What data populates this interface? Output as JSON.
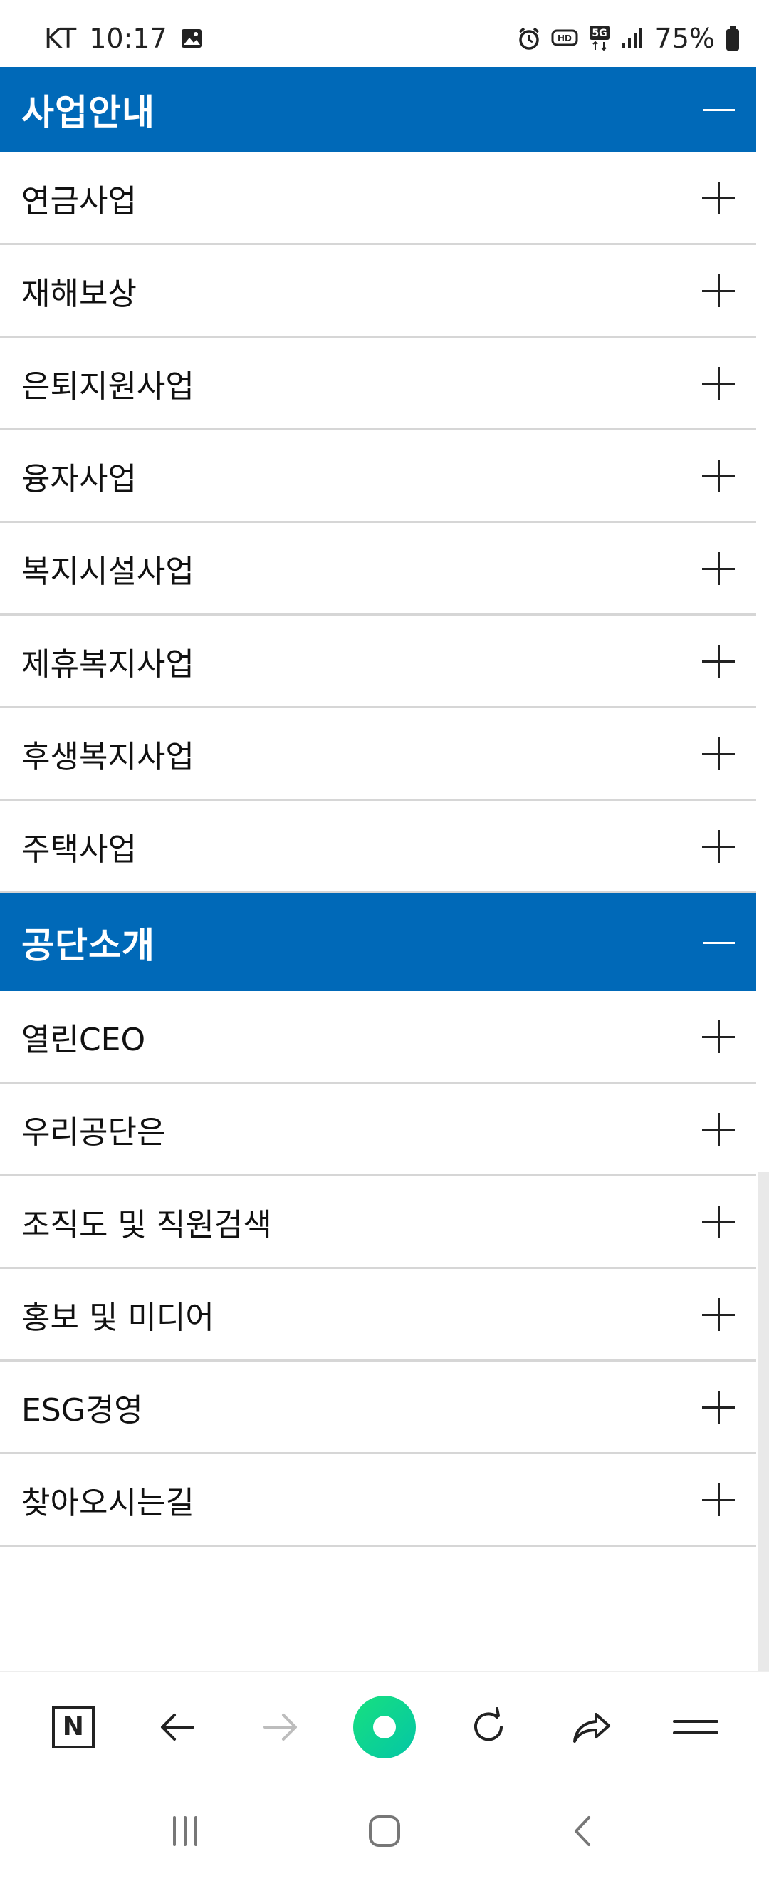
{
  "status_bar": {
    "carrier": "KT",
    "time": "10:17",
    "battery": "75%"
  },
  "sections": [
    {
      "title": "사업안내",
      "items": [
        "연금사업",
        "재해보상",
        "은퇴지원사업",
        "융자사업",
        "복지시설사업",
        "제휴복지사업",
        "후생복지사업",
        "주택사업"
      ]
    },
    {
      "title": "공단소개",
      "items": [
        "열린CEO",
        "우리공단은",
        "조직도 및 직원검색",
        "홍보 및 미디어",
        "ESG경영",
        "찾아오시는길"
      ]
    }
  ],
  "toolbar": {
    "n_label": "N"
  },
  "colors": {
    "header_blue": "#0069b8",
    "accent_green": "#17e07f"
  }
}
